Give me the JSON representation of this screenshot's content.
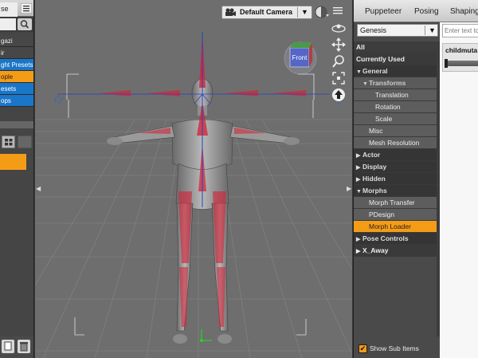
{
  "left_panel": {
    "tab_label": "se",
    "items": [
      {
        "label": "gazi",
        "style": "plain"
      },
      {
        "label": "ir",
        "style": "plain"
      },
      {
        "label": "ght Presets",
        "style": "blue"
      },
      {
        "label": "ople",
        "style": "orange"
      },
      {
        "label": "esets",
        "style": "blue"
      },
      {
        "label": "ops",
        "style": "blue"
      }
    ]
  },
  "viewport": {
    "camera_label": "Default Camera",
    "cube_label": "Front"
  },
  "right_panel": {
    "tabs": [
      "Puppeteer",
      "Posing",
      "Shaping"
    ],
    "figure_select": "Genesis",
    "tree": [
      {
        "label": "All",
        "style": "hdr-top",
        "indent": 0
      },
      {
        "label": "Currently Used",
        "style": "hdr",
        "indent": 0
      },
      {
        "label": "General",
        "style": "grp",
        "indent": 0,
        "tri": "▼"
      },
      {
        "label": "Transforms",
        "style": "grp2",
        "indent": 1,
        "tri": "▼"
      },
      {
        "label": "Translation",
        "style": "sub",
        "indent": 3
      },
      {
        "label": "Rotation",
        "style": "sub",
        "indent": 3
      },
      {
        "label": "Scale",
        "style": "sub",
        "indent": 3
      },
      {
        "label": "Misc",
        "style": "sub",
        "indent": 2
      },
      {
        "label": "Mesh Resolution",
        "style": "sub",
        "indent": 2
      },
      {
        "label": "Actor",
        "style": "grp",
        "indent": 0,
        "tri": "▶"
      },
      {
        "label": "Display",
        "style": "grp",
        "indent": 0,
        "tri": "▶"
      },
      {
        "label": "Hidden",
        "style": "grp",
        "indent": 0,
        "tri": "▶"
      },
      {
        "label": "Morphs",
        "style": "grp",
        "indent": 0,
        "tri": "▼"
      },
      {
        "label": "Morph Transfer",
        "style": "sub",
        "indent": 2
      },
      {
        "label": "PDesign",
        "style": "sub",
        "indent": 2
      },
      {
        "label": "Morph Loader",
        "style": "sel",
        "indent": 2
      },
      {
        "label": "Pose Controls",
        "style": "grp",
        "indent": 0,
        "tri": "▶"
      },
      {
        "label": "X_Away",
        "style": "hdr",
        "indent": 0,
        "tri": "▶"
      }
    ],
    "show_sub_items_label": "Show Sub Items",
    "show_sub_items_checked": true,
    "filter_placeholder": "Enter text to",
    "property_name": "childmuta"
  },
  "colors": {
    "accent": "#f59c17",
    "select_blue": "#1a76c8"
  }
}
